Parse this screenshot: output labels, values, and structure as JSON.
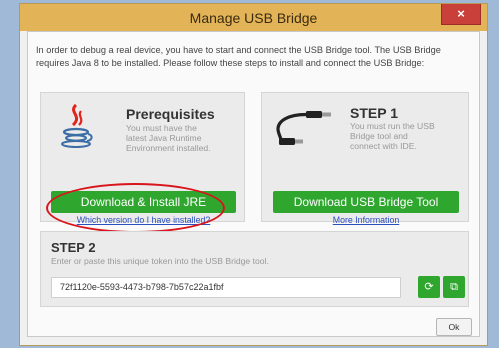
{
  "window": {
    "title": "Manage USB Bridge",
    "close_label": "×"
  },
  "intro_text": "In order to debug a real device, you have to start and connect the USB Bridge tool. The USB Bridge requires Java 8 to be installed. Please follow these steps to install and connect the USB Bridge:",
  "prerequisites": {
    "heading": "Prerequisites",
    "description_lines": [
      "You must have the",
      "latest Java Runtime",
      "Environment installed."
    ],
    "button_label": "Download & Install JRE",
    "link_label": "Which version do I have installed?",
    "icon": "java-icon"
  },
  "step1": {
    "heading": "STEP 1",
    "description_lines": [
      "You must run the USB",
      "Bridge tool and",
      "connect with IDE."
    ],
    "button_label": "Download USB Bridge Tool",
    "link_label": "More Information",
    "icon": "usb-cable-icon"
  },
  "step2": {
    "heading": "STEP 2",
    "description": "Enter or paste this unique token into the USB Bridge tool.",
    "token_value": "72f1120e-5593-4473-b798-7b57c22a1fbf",
    "refresh_icon": "refresh-icon",
    "copy_icon": "copy-icon"
  },
  "footer": {
    "ok_label": "Ok"
  },
  "colors": {
    "titlebar": "#e2b457",
    "close": "#c9403b",
    "accent_green": "#2fa72f",
    "highlight_red": "#d9141b",
    "link": "#2a4fbf"
  }
}
